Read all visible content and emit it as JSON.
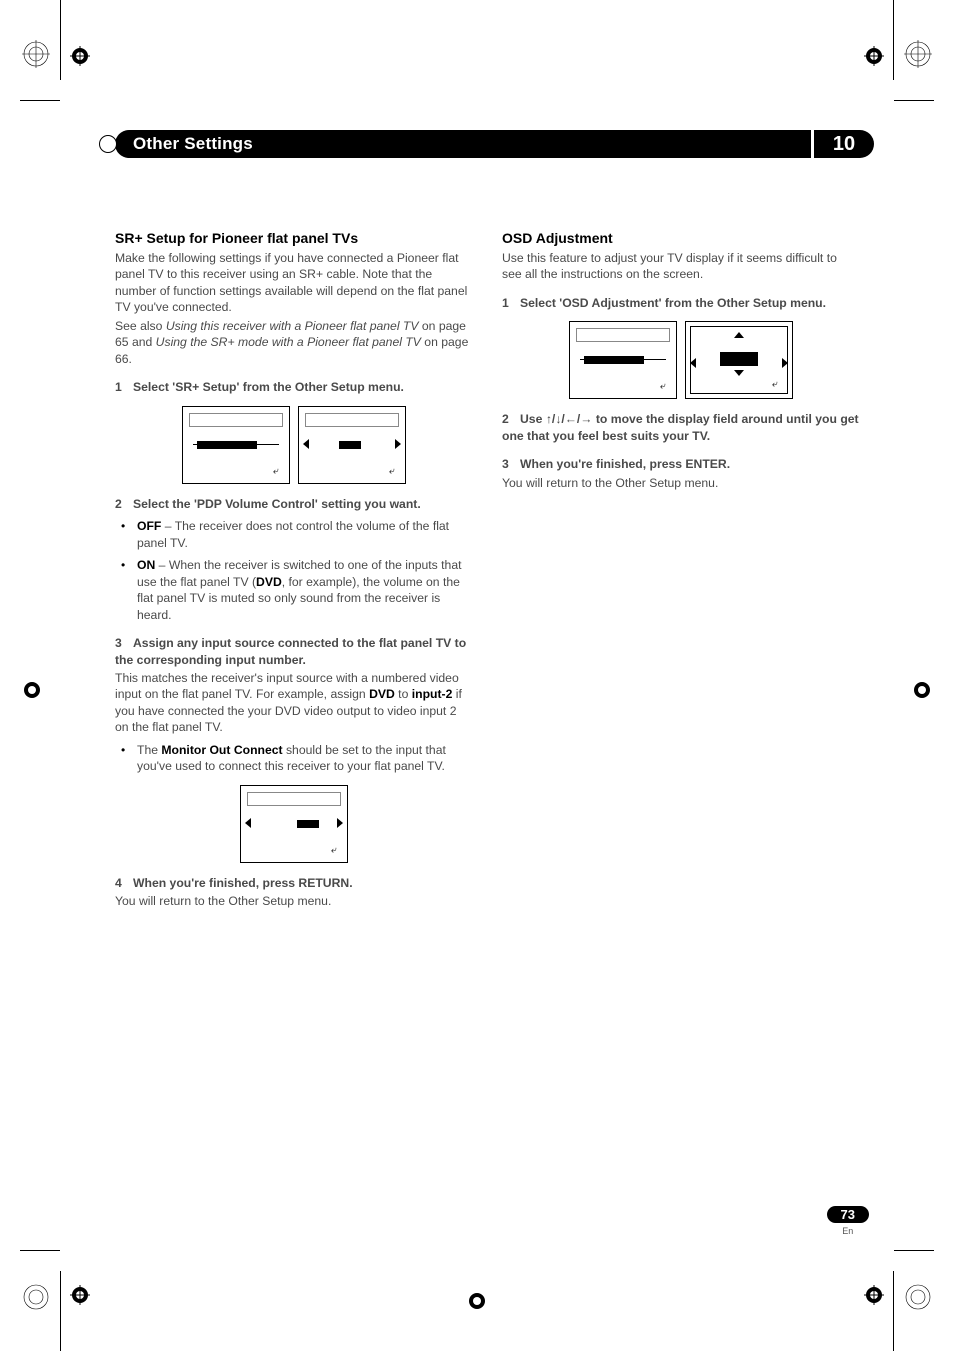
{
  "header": {
    "title": "Other Settings",
    "chapter": "10"
  },
  "left": {
    "h2": "SR+ Setup for Pioneer flat panel TVs",
    "intro1": "Make the following settings if you have connected a Pioneer flat panel TV to this receiver using an SR+ cable. Note that the number of function settings available will depend on the flat panel TV you've connected.",
    "seealso_pre": "See also ",
    "seealso_ref1": "Using this receiver with a Pioneer flat panel TV",
    "seealso_mid1": " on page 65 and ",
    "seealso_ref2": "Using the SR+ mode with a Pioneer flat panel TV",
    "seealso_mid2": " on page 66.",
    "step1": "Select 'SR+ Setup' from the Other Setup menu.",
    "step2": "Select the 'PDP Volume Control' setting you want.",
    "off_label": "OFF",
    "off_text": " – The receiver does not control the volume of the flat panel TV.",
    "on_label": "ON",
    "on_text_a": " – When the receiver is switched to one of the inputs that use the flat panel TV (",
    "on_dvd": "DVD",
    "on_text_b": ", for example), the volume on the flat panel TV is muted so only sound from the receiver is heard.",
    "step3": "Assign any input source connected to the flat panel TV to the corresponding input number.",
    "assign_a": "This matches the receiver's input source with a numbered video input on the flat panel TV. For example, assign ",
    "assign_dvd": "DVD",
    "assign_b": " to ",
    "assign_input2": "input-2",
    "assign_c": " if you have connected the your DVD video output to video input 2 on the flat panel TV.",
    "monitor_pre": "The ",
    "monitor_bold": "Monitor Out Connect",
    "monitor_post": " should be set to the input that you've used to connect this receiver to your flat panel TV.",
    "step4": "When you're finished, press RETURN.",
    "return_text": "You will return to the Other Setup menu."
  },
  "right": {
    "h2": "OSD Adjustment",
    "intro": "Use this feature to adjust your TV display if it seems difficult to see all the instructions on the screen.",
    "step1": "Select 'OSD Adjustment' from the Other Setup menu.",
    "step2_a": "Use ",
    "step2_arrows": "↑/↓/←/→",
    "step2_b": " to move the display field around until you get one that you feel best suits your TV.",
    "step3": "When you're finished, press ENTER.",
    "return_text": "You will return to the Other Setup menu."
  },
  "page": {
    "number": "73",
    "lang": "En"
  },
  "steps": {
    "n1": "1",
    "n2": "2",
    "n3": "3",
    "n4": "4"
  }
}
